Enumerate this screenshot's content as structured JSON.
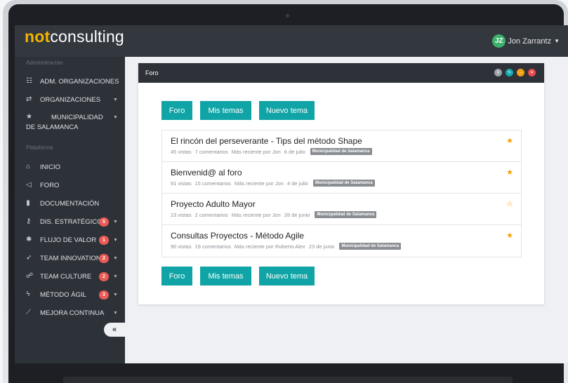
{
  "app": {
    "logo_bold": "not",
    "logo_rest": "consulting"
  },
  "user": {
    "initials": "JZ",
    "name": "Jon Zarrantz"
  },
  "sidebar": {
    "section_admin": "Administración",
    "section_platform": "Plataforma",
    "admin_items": [
      {
        "icon": "users-icon",
        "label": "ADM. ORGANIZACIONES"
      },
      {
        "icon": "exchange-icon",
        "label": "ORGANIZACIONES"
      },
      {
        "icon": "star-icon",
        "label": "MUNICIPALIDAD DE SALAMANCA"
      }
    ],
    "platform_items": [
      {
        "icon": "home-icon",
        "label": "INICIO"
      },
      {
        "icon": "megaphone-icon",
        "label": "FORO"
      },
      {
        "icon": "file-icon",
        "label": "DOCUMENTACIÓN"
      },
      {
        "icon": "key-icon",
        "label": "DIS. ESTRATÉGICO",
        "badge": "5"
      },
      {
        "icon": "gear-icon",
        "label": "FLUJO DE VALOR",
        "badge": "1"
      },
      {
        "icon": "rocket-icon",
        "label": "TEAM INNOVATION",
        "badge": "2"
      },
      {
        "icon": "group-icon",
        "label": "TEAM CULTURE",
        "badge": "2"
      },
      {
        "icon": "lightning-icon",
        "label": "MÉTODO ÁGIL",
        "badge": "3"
      },
      {
        "icon": "chart-icon",
        "label": "MEJORA CONTINUA"
      }
    ],
    "collapse_glyph": "«"
  },
  "panel": {
    "title": "Foro",
    "controls": [
      {
        "icon": "link-icon",
        "color": "#9aa1a9",
        "glyph": "⚲"
      },
      {
        "icon": "refresh-icon",
        "color": "#12a9b0",
        "glyph": "↻"
      },
      {
        "icon": "minimize-icon",
        "color": "#f3a112",
        "glyph": "–"
      },
      {
        "icon": "close-icon",
        "color": "#e84c4c",
        "glyph": "✕"
      }
    ],
    "buttons": {
      "foro": "Foro",
      "mis_temas": "Mis temas",
      "nuevo_tema": "Nuevo tema"
    }
  },
  "topics": [
    {
      "title": "El rincón del perseverante - Tips del método Shape",
      "views": "45 vistas",
      "comments": "7 comentarios",
      "recent": "Más reciente por Jon",
      "date": "6 de julio",
      "tag": "Municipalidad de Salamanca",
      "starred": true
    },
    {
      "title": "Bienvenid@ al foro",
      "views": "91 vistas",
      "comments": "15 comentarios",
      "recent": "Más reciente por Jon",
      "date": "4 de julio",
      "tag": "Municipalidad de Salamanca",
      "starred": true
    },
    {
      "title": "Proyecto Adulto Mayor",
      "views": "23 vistas",
      "comments": "2 comentarios",
      "recent": "Más reciente por Jon",
      "date": "28 de junio",
      "tag": "Municipalidad de Salamanca",
      "starred": false
    },
    {
      "title": "Consultas Proyectos - Método Agile",
      "views": "90 vistas",
      "comments": "19 comentarios",
      "recent": "Más reciente por Roberto Alex",
      "date": "23 de junio",
      "tag": "Municipalidad de Salamanca",
      "starred": true
    }
  ]
}
